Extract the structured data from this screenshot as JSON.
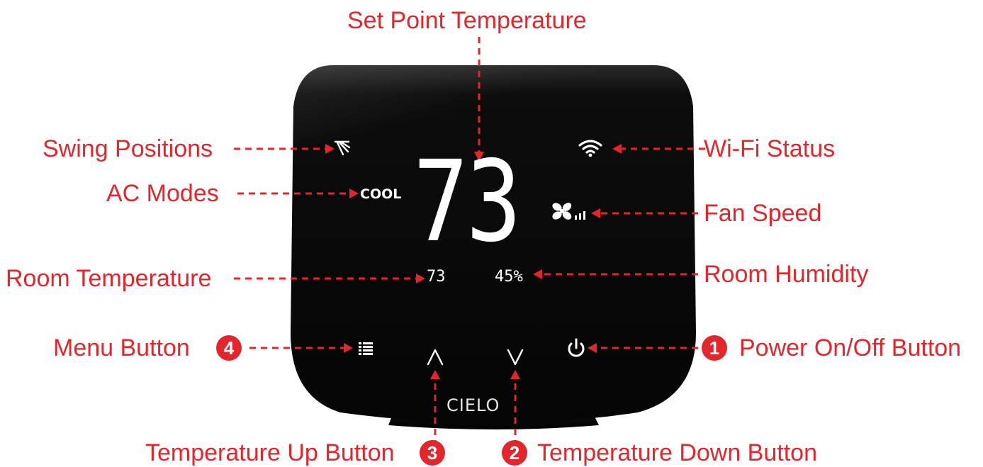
{
  "labels": {
    "set_point": "Set Point Temperature",
    "swing": "Swing Positions",
    "wifi": "Wi-Fi Status",
    "ac_modes": "AC Modes",
    "fan_speed": "Fan Speed",
    "room_temp": "Room Temperature",
    "room_humidity": "Room Humidity",
    "menu": "Menu Button",
    "power": "Power On/Off Button",
    "temp_up": "Temperature Up Button",
    "temp_down": "Temperature Down Button"
  },
  "badges": {
    "menu": "4",
    "power": "1",
    "temp_up": "3",
    "temp_down": "2"
  },
  "device": {
    "mode": "COOL",
    "set_point": "73",
    "room_temp": "73",
    "room_humidity": "45%",
    "brand": "CIELO",
    "icons": [
      "swing-icon",
      "wifi-icon",
      "fan-icon",
      "fan-speed-bars-icon",
      "menu-icon",
      "chevron-up-icon",
      "chevron-down-icon",
      "power-icon"
    ]
  },
  "colors": {
    "annotation": "#e3262b",
    "device_body": "#0a0a0a",
    "display_text": "#ffffff"
  }
}
